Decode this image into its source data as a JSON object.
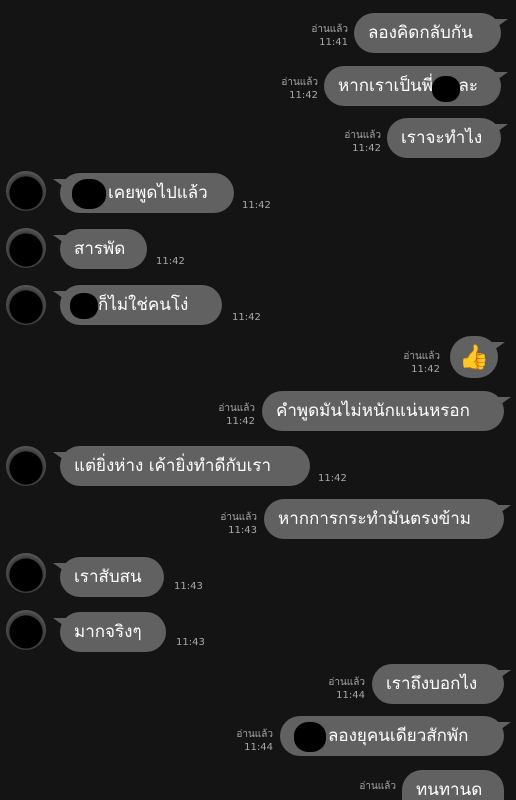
{
  "read_label": "อ่านแล้ว",
  "messages": [
    {
      "text": "ลองคิดกลับกัน",
      "time": "11:41"
    },
    {
      "text": "หากเราเป็นพี่ๆ และ",
      "time": "11:42"
    },
    {
      "text": "เราจะทำไง",
      "time": "11:42"
    },
    {
      "text": "เคยพูดไปแล้ว",
      "time": "11:42"
    },
    {
      "text": "สารพัด",
      "time": "11:42"
    },
    {
      "text": "ก็ไม่ใช่คนโง่",
      "time": "11:42"
    },
    {
      "text": "👍",
      "time": "11:42"
    },
    {
      "text": "คำพูดมันไม่หนักแน่นหรอก",
      "time": "11:42"
    },
    {
      "text": "แต่ยิ่งห่าง เค้ายิ่งทำดีกับเรา",
      "time": "11:42"
    },
    {
      "text": "หากการกระทำมันตรงข้าม",
      "time": "11:43"
    },
    {
      "text": "เราสับสน",
      "time": "11:43"
    },
    {
      "text": "มากจริงๆ",
      "time": "11:43"
    },
    {
      "text": "เราถึงบอกไง",
      "time": "11:44"
    },
    {
      "text": "ลองยุคนเดียวสักพัก",
      "time": "11:44"
    },
    {
      "text": "ทนทานด",
      "time": ""
    }
  ]
}
